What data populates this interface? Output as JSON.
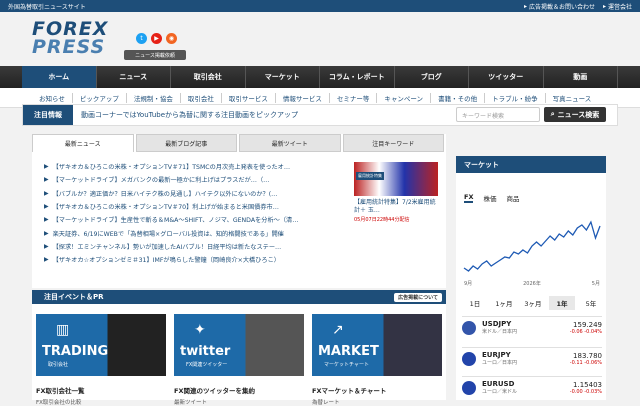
{
  "topbar": {
    "site": "外国為替取引ニュースサイト",
    "ad": "広告掲載＆お問い合わせ",
    "company": "運営会社"
  },
  "header": {
    "logo1": "FOREX",
    "logo2": "PRESS",
    "news_btn": "ニュース掲載依頼"
  },
  "gnav": [
    "ホーム",
    "ニュース",
    "取引会社",
    "マーケット",
    "コラム・レポート",
    "ブログ",
    "ツイッター",
    "動画"
  ],
  "snav": [
    "お知らせ",
    "ピックアップ",
    "法規制・協会",
    "取引会社",
    "取引サービス",
    "情報サービス",
    "セミナー等",
    "キャンペーン",
    "書籍・その他",
    "トラブル・紛争",
    "写真ニュース"
  ],
  "notice": {
    "tag": "注目情報",
    "msg": "動画コーナーではYouTubeから為替に関する注目動画をピックアップ"
  },
  "search": {
    "placeholder": "キーワード検索",
    "button": "ニュース検索"
  },
  "tabs": [
    "最新ニュース",
    "最新ブログ記事",
    "最新ツイート",
    "注目キーワード"
  ],
  "news": [
    "【ザキオカ＆ひろこの米株・オプションTV＃71】TSMCの月次売上発表を使ったオ…",
    "【マーケットドライブ】メガバンクの最新一極かに利上げはプラスだが…（…",
    "【バブルか？適正価か？日米ハイテク株の見通し】ハイテク以外にないのか？(…",
    "【ザキオカ＆ひろこの米株・オプションTV＃70】利上げが始まると米国債券市…",
    "【マーケットドライブ】生産性で斬る＆M&A〜SHIFT、ノジマ、GENDAを分析〜（清…",
    "楽天証券、6/19にWEBで「為替相場×グローバル投資は、知的格闘技である」開催",
    "【探求！エミンチャンネル】勢いが加速したAIバブル！日経平均は新たなステー…",
    "【ザキオカ☆オプションゼミ＃31】IMFが鳴らした警鐘（岡崎良介×大橋ひろこ）"
  ],
  "featured": {
    "badge": "雇用統計特集",
    "title": "【雇用統計特集】7/2米雇用統計＋ 玉…",
    "date": "05月07日22時44分配信"
  },
  "events": {
    "title": "注目イベント＆PR",
    "ad": "広告掲載について",
    "cards": [
      {
        "label": "TRADING",
        "sub": "取引会社",
        "title": "FX取引会社一覧",
        "desc": "FX取引会社の比較"
      },
      {
        "label": "twitter",
        "sub": "FX関連ツイッター",
        "title": "FX関連のツイッターを集約",
        "desc": "最新ツイート"
      },
      {
        "label": "MARKET",
        "sub": "マーケットチャート",
        "title": "FXマーケット＆チャート",
        "desc": "為替レート"
      }
    ]
  },
  "market": {
    "title": "マーケット",
    "tabs": [
      "FX",
      "株価",
      "商品"
    ],
    "axis": [
      "9月",
      "2026年",
      "5月"
    ],
    "periods": [
      "1日",
      "1ヶ月",
      "3ヶ月",
      "1年",
      "5年"
    ],
    "quotes": [
      {
        "pair": "USDJPY",
        "jp": "米ドル／日本円",
        "price": "159.249",
        "chg": "-0.06  -0.04%",
        "flag": "#3355aa"
      },
      {
        "pair": "EURJPY",
        "jp": "ユーロ／日本円",
        "price": "183.780",
        "chg": "-0.11  -0.06%",
        "flag": "#2244aa"
      },
      {
        "pair": "EURUSD",
        "jp": "ユーロ／米ドル",
        "price": "1.15403",
        "chg": "-0.00  -0.03%",
        "flag": "#2244aa"
      }
    ]
  },
  "chart_data": {
    "type": "line",
    "values": [
      52,
      55,
      50,
      53,
      48,
      45,
      50,
      47,
      44,
      41,
      42,
      36,
      38,
      34,
      37,
      30,
      26,
      30,
      25,
      20,
      24,
      18,
      21,
      15,
      19,
      12,
      9,
      14,
      6,
      22,
      10
    ]
  },
  "colors": {
    "brand": "#1e4e79",
    "accent": "#c00"
  }
}
